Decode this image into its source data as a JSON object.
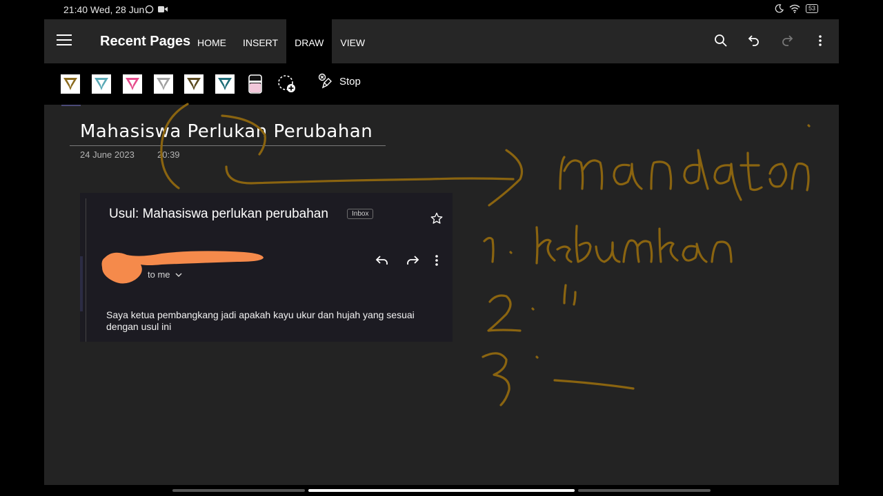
{
  "status_bar": {
    "time": "21:40 Wed, 28 Jun",
    "battery": "53"
  },
  "header": {
    "title": "Recent Pages",
    "tabs": [
      {
        "label": "HOME",
        "active": false
      },
      {
        "label": "INSERT",
        "active": false
      },
      {
        "label": "DRAW",
        "active": true
      },
      {
        "label": "VIEW",
        "active": false
      }
    ],
    "actions": [
      "search-icon",
      "undo-icon",
      "redo-icon",
      "more-icon"
    ]
  },
  "draw_toolbar": {
    "pens": [
      {
        "name": "pen-brown",
        "color": "#8b6b1e"
      },
      {
        "name": "pen-teal",
        "color": "#5aa9b6"
      },
      {
        "name": "pen-pink",
        "color": "#e64b8b"
      },
      {
        "name": "pen-gray",
        "color": "#a0a0a0"
      },
      {
        "name": "pen-dark-brown",
        "color": "#5b4a20"
      },
      {
        "name": "pen-dark-teal",
        "color": "#1f6e79"
      }
    ],
    "highlighter_color": "#f2c7da",
    "stop_label": "Stop"
  },
  "page": {
    "title": "Mahasiswa Perlukan Perubahan",
    "date": "24 June 2023",
    "time": "20:39"
  },
  "email": {
    "subject": "Usul: Mahasiswa perlukan perubahan",
    "badge": "Inbox",
    "to": "to me",
    "body": "Saya ketua pembangkang jadi apakah kayu ukur dan hujah yang sesuai dengan usul ini"
  },
  "colors": {
    "ink": "#8a6410",
    "app_background": "#232323",
    "redaction": "#f58a4b"
  }
}
